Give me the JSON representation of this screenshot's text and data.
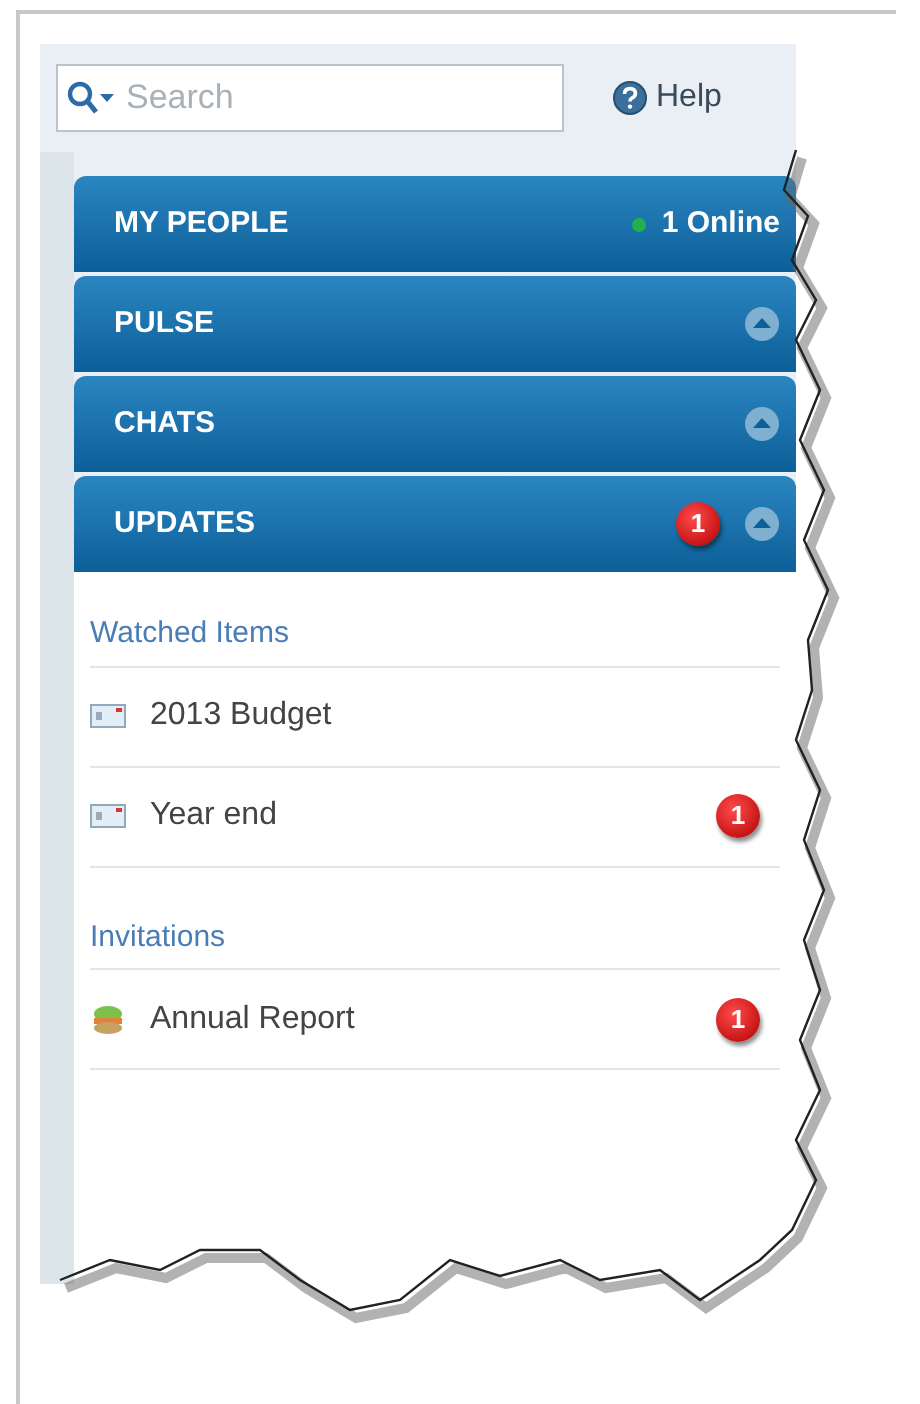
{
  "search": {
    "placeholder": "Search"
  },
  "help": {
    "label": "Help"
  },
  "sections": [
    {
      "title": "MY PEOPLE",
      "status": "1 Online"
    },
    {
      "title": "PULSE"
    },
    {
      "title": "CHATS"
    },
    {
      "title": "UPDATES",
      "badge": "1"
    }
  ],
  "groups": [
    {
      "title": "Watched Items",
      "items": [
        {
          "label": "2013 Budget",
          "kind": "document"
        },
        {
          "label": "Year end",
          "kind": "document",
          "badge": "1"
        }
      ]
    },
    {
      "title": "Invitations",
      "items": [
        {
          "label": "Annual Report",
          "kind": "invitation",
          "badge": "1"
        }
      ]
    }
  ]
}
